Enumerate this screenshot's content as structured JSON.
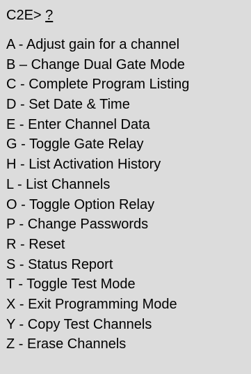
{
  "prompt": {
    "label": "C2E>",
    "input": "?"
  },
  "menu": {
    "items": [
      {
        "label": "A - Adjust gain for a channel"
      },
      {
        "label": "B – Change Dual Gate Mode"
      },
      {
        "label": "C - Complete Program Listing"
      },
      {
        "label": "D - Set Date & Time"
      },
      {
        "label": "E - Enter Channel Data"
      },
      {
        "label": "G - Toggle Gate Relay"
      },
      {
        "label": "H - List Activation History"
      },
      {
        "label": "L - List Channels"
      },
      {
        "label": "O - Toggle Option Relay"
      },
      {
        "label": "P - Change Passwords"
      },
      {
        "label": "R - Reset"
      },
      {
        "label": "S - Status Report"
      },
      {
        "label": "T - Toggle Test Mode"
      },
      {
        "label": "X - Exit Programming Mode"
      },
      {
        "label": "Y - Copy Test Channels"
      },
      {
        "label": "Z - Erase Channels"
      }
    ]
  }
}
